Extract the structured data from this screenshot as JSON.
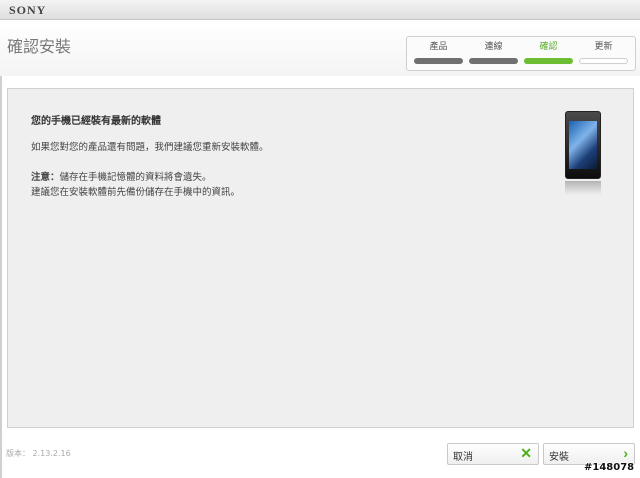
{
  "window": {
    "brand": "SONY"
  },
  "header": {
    "title": "確認安裝"
  },
  "steps": [
    {
      "label": "產品",
      "state": "done"
    },
    {
      "label": "連線",
      "state": "done"
    },
    {
      "label": "確認",
      "state": "active"
    },
    {
      "label": "更新",
      "state": "pending"
    }
  ],
  "content": {
    "heading": "您的手機已經裝有最新的軟體",
    "line1": "如果您對您的產品還有問題，我們建議您重新安裝軟體。",
    "note_label": "注意：",
    "note_text": "儲存在手機記憶體的資料將會遺失。",
    "line3": "建議您在安裝軟體前先備份儲存在手機中的資訊。"
  },
  "footer": {
    "version": "版本： 2.13.2.16",
    "cancel_label": "取消",
    "install_label": "安裝",
    "watermark": "#148078"
  },
  "colors": {
    "accent": "#6cbd34",
    "step_done": "#707070"
  },
  "icons": {
    "cancel": "close-icon",
    "install": "chevron-right-icon"
  }
}
